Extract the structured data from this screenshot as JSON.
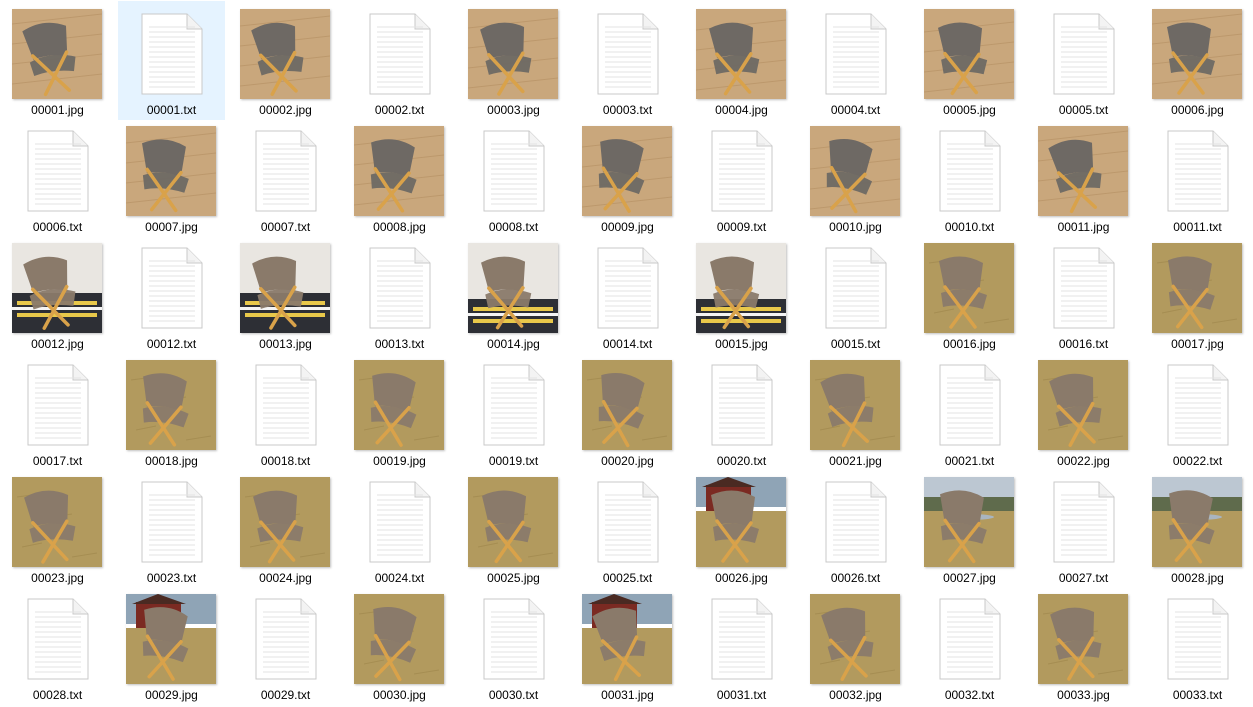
{
  "explorer": {
    "view": "large-icons",
    "selected_index": 1,
    "colors": {
      "selection_bg": "#e5f3ff",
      "label_text": "#000000",
      "background": "#ffffff",
      "wood": "#d9a24a",
      "upholstery_grey": "#6e6964",
      "upholstery_brown": "#8a7a6a",
      "floor_wood": "#c9a77c",
      "grass": "#b29a5e"
    },
    "items": [
      {
        "name": "00001.jpg",
        "type": "image",
        "scene": "indoor",
        "chair": "grey"
      },
      {
        "name": "00001.txt",
        "type": "text"
      },
      {
        "name": "00002.jpg",
        "type": "image",
        "scene": "indoor",
        "chair": "grey"
      },
      {
        "name": "00002.txt",
        "type": "text"
      },
      {
        "name": "00003.jpg",
        "type": "image",
        "scene": "indoor",
        "chair": "grey"
      },
      {
        "name": "00003.txt",
        "type": "text"
      },
      {
        "name": "00004.jpg",
        "type": "image",
        "scene": "indoor",
        "chair": "grey"
      },
      {
        "name": "00004.txt",
        "type": "text"
      },
      {
        "name": "00005.jpg",
        "type": "image",
        "scene": "indoor",
        "chair": "grey"
      },
      {
        "name": "00005.txt",
        "type": "text"
      },
      {
        "name": "00006.jpg",
        "type": "image",
        "scene": "indoor",
        "chair": "grey"
      },
      {
        "name": "00006.txt",
        "type": "text"
      },
      {
        "name": "00007.jpg",
        "type": "image",
        "scene": "indoor",
        "chair": "grey"
      },
      {
        "name": "00007.txt",
        "type": "text"
      },
      {
        "name": "00008.jpg",
        "type": "image",
        "scene": "indoor",
        "chair": "grey"
      },
      {
        "name": "00008.txt",
        "type": "text"
      },
      {
        "name": "00009.jpg",
        "type": "image",
        "scene": "indoor",
        "chair": "grey"
      },
      {
        "name": "00009.txt",
        "type": "text"
      },
      {
        "name": "00010.jpg",
        "type": "image",
        "scene": "indoor",
        "chair": "grey"
      },
      {
        "name": "00010.txt",
        "type": "text"
      },
      {
        "name": "00011.jpg",
        "type": "image",
        "scene": "indoor",
        "chair": "grey"
      },
      {
        "name": "00011.txt",
        "type": "text"
      },
      {
        "name": "00012.jpg",
        "type": "image",
        "scene": "rug",
        "chair": "brown"
      },
      {
        "name": "00012.txt",
        "type": "text"
      },
      {
        "name": "00013.jpg",
        "type": "image",
        "scene": "rug",
        "chair": "brown"
      },
      {
        "name": "00013.txt",
        "type": "text"
      },
      {
        "name": "00014.jpg",
        "type": "image",
        "scene": "rug",
        "chair": "brown"
      },
      {
        "name": "00014.txt",
        "type": "text"
      },
      {
        "name": "00015.jpg",
        "type": "image",
        "scene": "rug",
        "chair": "brown"
      },
      {
        "name": "00015.txt",
        "type": "text"
      },
      {
        "name": "00016.jpg",
        "type": "image",
        "scene": "grass",
        "chair": "brown"
      },
      {
        "name": "00016.txt",
        "type": "text"
      },
      {
        "name": "00017.jpg",
        "type": "image",
        "scene": "grass",
        "chair": "brown"
      },
      {
        "name": "00017.txt",
        "type": "text"
      },
      {
        "name": "00018.jpg",
        "type": "image",
        "scene": "grass",
        "chair": "brown"
      },
      {
        "name": "00018.txt",
        "type": "text"
      },
      {
        "name": "00019.jpg",
        "type": "image",
        "scene": "grass",
        "chair": "brown"
      },
      {
        "name": "00019.txt",
        "type": "text"
      },
      {
        "name": "00020.jpg",
        "type": "image",
        "scene": "grass",
        "chair": "brown"
      },
      {
        "name": "00020.txt",
        "type": "text"
      },
      {
        "name": "00021.jpg",
        "type": "image",
        "scene": "grass",
        "chair": "brown"
      },
      {
        "name": "00021.txt",
        "type": "text"
      },
      {
        "name": "00022.jpg",
        "type": "image",
        "scene": "grass",
        "chair": "brown"
      },
      {
        "name": "00022.txt",
        "type": "text"
      },
      {
        "name": "00023.jpg",
        "type": "image",
        "scene": "grass",
        "chair": "brown"
      },
      {
        "name": "00023.txt",
        "type": "text"
      },
      {
        "name": "00024.jpg",
        "type": "image",
        "scene": "grass",
        "chair": "brown"
      },
      {
        "name": "00024.txt",
        "type": "text"
      },
      {
        "name": "00025.jpg",
        "type": "image",
        "scene": "grass",
        "chair": "brown"
      },
      {
        "name": "00025.txt",
        "type": "text"
      },
      {
        "name": "00026.jpg",
        "type": "image",
        "scene": "grass-house",
        "chair": "brown"
      },
      {
        "name": "00026.txt",
        "type": "text"
      },
      {
        "name": "00027.jpg",
        "type": "image",
        "scene": "field",
        "chair": "brown"
      },
      {
        "name": "00027.txt",
        "type": "text"
      },
      {
        "name": "00028.jpg",
        "type": "image",
        "scene": "field",
        "chair": "brown"
      },
      {
        "name": "00028.txt",
        "type": "text"
      },
      {
        "name": "00029.jpg",
        "type": "image",
        "scene": "grass-house",
        "chair": "brown"
      },
      {
        "name": "00029.txt",
        "type": "text"
      },
      {
        "name": "00030.jpg",
        "type": "image",
        "scene": "grass",
        "chair": "brown"
      },
      {
        "name": "00030.txt",
        "type": "text"
      },
      {
        "name": "00031.jpg",
        "type": "image",
        "scene": "grass-house",
        "chair": "brown"
      },
      {
        "name": "00031.txt",
        "type": "text"
      },
      {
        "name": "00032.jpg",
        "type": "image",
        "scene": "grass",
        "chair": "brown"
      },
      {
        "name": "00032.txt",
        "type": "text"
      },
      {
        "name": "00033.jpg",
        "type": "image",
        "scene": "grass",
        "chair": "brown"
      },
      {
        "name": "00033.txt",
        "type": "text"
      }
    ]
  }
}
